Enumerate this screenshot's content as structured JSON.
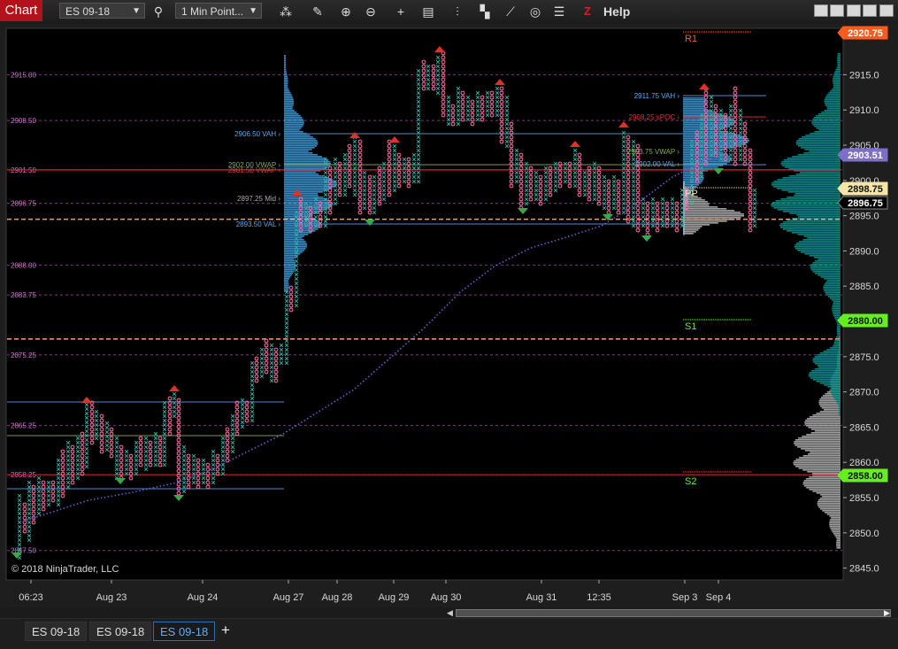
{
  "toolbar": {
    "chart_label": "Chart",
    "instrument": "ES 09-18",
    "interval": "1 Min Point...",
    "help_label": "Help",
    "z_label": "Z"
  },
  "chart": {
    "copyright": "© 2018 NinjaTrader, LLC",
    "y_ticks": [
      "2915.0",
      "2910.0",
      "2905.0",
      "2900.0",
      "2895.0",
      "2890.0",
      "2885.0",
      "2880.0",
      "2875.0",
      "2870.0",
      "2865.0",
      "2860.0",
      "2855.0",
      "2850.0",
      "2845.0"
    ],
    "x_ticks": [
      "06:23",
      "Aug 23",
      "Aug 24",
      "Aug 27",
      "Aug 28",
      "Aug 29",
      "Aug 30",
      "Aug 31",
      "12:35",
      "Sep 3",
      "Sep 4"
    ],
    "left_levels": [
      "2915.00",
      "2908.50",
      "2901.50",
      "2896.75",
      "2888.00",
      "2883.75",
      "2875.25",
      "2865.25",
      "2858.25",
      "2847.50"
    ],
    "profile_labels": {
      "vah": "2906.50 VAH",
      "vwap": "2902.00 VWAP",
      "vwap2": "2901.50 VWAP",
      "mid": "2897.25 Mid",
      "val": "2893.50 VAL",
      "vah2": "2911.75 VAH",
      "poc2": "2908.25 sPOC",
      "vwap3": "2903.75 VWAP",
      "val2": "2902.00 VAL"
    },
    "pivots": {
      "r1": "R1",
      "pp": "PP",
      "s1": "S1",
      "s2": "S2"
    },
    "price_badges": [
      {
        "value": "2920.75",
        "color": "#ff5a1e"
      },
      {
        "value": "2903.51",
        "color": "#7d6fc8"
      },
      {
        "value": "2898.75",
        "color": "#f5e6a8"
      },
      {
        "value": "2896.75",
        "color": "#000000"
      },
      {
        "value": "2880.00",
        "color": "#66ee22"
      },
      {
        "value": "2858.00",
        "color": "#66ee22"
      }
    ],
    "colors": {
      "up_x": "#2ab5a8",
      "down_o": "#ff6aa8",
      "profile_blue": "#4d9fd4",
      "profile_teal": "#1a8f8f",
      "profile_gray": "#bbbbbb",
      "vwap_dots": "#6a5ccc",
      "red_line": "#e0202a",
      "orange_dash": "#ff9966",
      "grid_dash": "#7a3a7a"
    }
  },
  "tabs": [
    "ES 09-18",
    "ES 09-18",
    "ES 09-18"
  ],
  "active_tab": "ES 09-18",
  "add_tab_label": "+"
}
